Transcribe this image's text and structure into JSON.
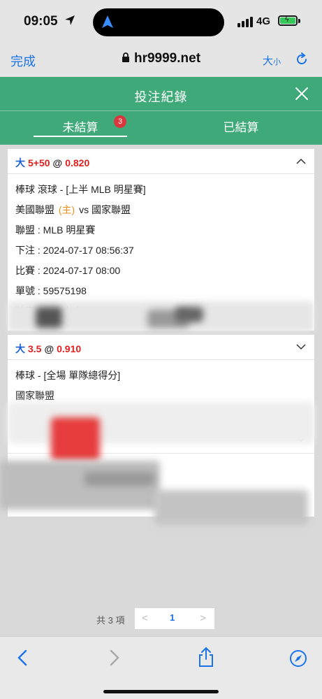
{
  "status_bar": {
    "time": "09:05",
    "network": "4G"
  },
  "browser": {
    "done_label": "完成",
    "url": "hr9999.net",
    "text_size_big": "大",
    "text_size_small": "小"
  },
  "header": {
    "title": "投注紀錄",
    "tabs": [
      {
        "label": "未結算",
        "badge": "3"
      },
      {
        "label": "已結算"
      }
    ]
  },
  "bets": [
    {
      "pick": "大",
      "line": "5+50",
      "at": "@",
      "odds": "0.820",
      "sport": "棒球 滾球 - [上半 MLB 明星賽]",
      "team_home": "美國聯盟",
      "home_tag": "(主)",
      "vs": "vs",
      "team_away": "國家聯盟",
      "league": "聯盟 : MLB 明星賽",
      "bet_time": "下注 : 2024-07-17 08:56:37",
      "match_time": "比賽 : 2024-07-17 08:00",
      "ticket": "單號 : 59575198",
      "odds_type": "賠率 : 不含本金"
    },
    {
      "pick": "大",
      "line": "3.5",
      "at": "@",
      "odds": "0.910",
      "sport": "棒球 - [全場 單隊總得分]",
      "team": "國家聯盟"
    }
  ],
  "pagination": {
    "total": "共 3 項",
    "prev": "<",
    "page": "1",
    "next": ">"
  },
  "colors": {
    "header_green": "#3fa979",
    "link_blue": "#1a73e8",
    "odds_red": "#e0201f",
    "badge_red": "#d9363e",
    "home_tag_orange": "#f08c1a"
  }
}
